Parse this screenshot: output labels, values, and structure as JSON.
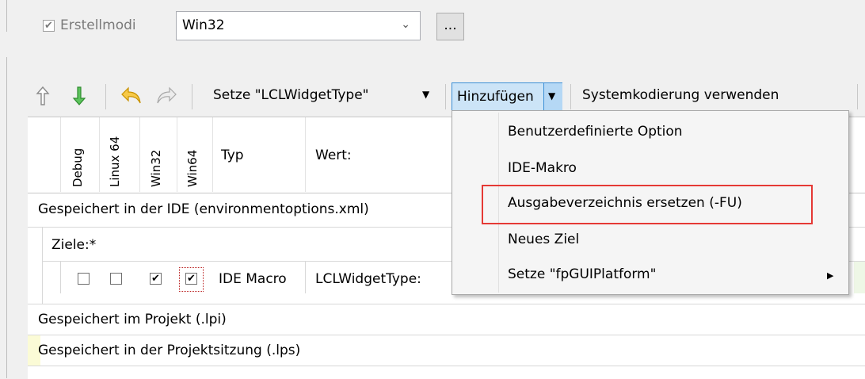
{
  "toolbar_top": {
    "build_modes_label": "Erstellmodi",
    "build_mode_value": "Win32",
    "more_label": "..."
  },
  "toolbar": {
    "set_widget_label": "Setze \"LCLWidgetType\"",
    "add_label": "Hinzufügen",
    "system_encoding_label": "Systemkodierung verwenden"
  },
  "grid": {
    "columns": {
      "debug": "Debug",
      "linux64": "Linux 64",
      "win32": "Win32",
      "win64": "Win64",
      "type": "Typ",
      "value": "Wert:"
    },
    "ide_group": "Gespeichert in der IDE (environmentoptions.xml)",
    "targets_group": "Ziele:*",
    "row": {
      "type": "IDE Macro",
      "value": "LCLWidgetType:",
      "check_mark": "✔"
    },
    "project_group": "Gespeichert im Projekt (.lpi)",
    "session_group": "Gespeichert in der Projektsitzung (.lps)"
  },
  "menu": {
    "items": [
      "Benutzerdefinierte Option",
      "IDE-Makro",
      "Ausgabeverzeichnis ersetzen (-FU)",
      "Neues Ziel",
      "Setze \"fpGUIPlatform\""
    ],
    "submenu_arrow": "▶"
  },
  "colors": {
    "highlight_border": "#e53935",
    "menu_background": "#f5f5f5",
    "add_button_active": "#cce4f7",
    "arrow_up": "#8a8a8a",
    "arrow_down": "#3aa33a",
    "undo": "#f4b400"
  }
}
